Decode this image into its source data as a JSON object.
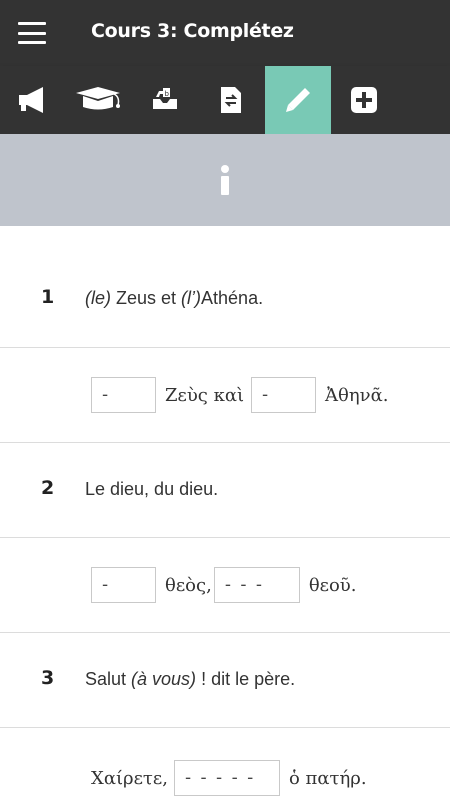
{
  "header": {
    "title": "Cours 3: Complétez"
  },
  "toolbar": {
    "tools": [
      {
        "icon": "megaphone-icon",
        "active": false
      },
      {
        "icon": "graduation-cap-icon",
        "active": false
      },
      {
        "icon": "inbox-icon",
        "active": false
      },
      {
        "icon": "document-swap-icon",
        "active": false
      },
      {
        "icon": "pencil-icon",
        "active": true
      },
      {
        "icon": "plus-square-icon",
        "active": false
      }
    ],
    "active_color": "#79c9b5"
  },
  "info": {
    "icon": "info-icon"
  },
  "exercises": [
    {
      "number": "1",
      "french_parts": {
        "a": "(le)",
        "b": " Zeus et ",
        "c": "(l’)",
        "d": "Athéna."
      },
      "greek": {
        "blank1": "-",
        "text1": "Ζεὺς καὶ",
        "blank2": "-",
        "text2": "Ἀθηνᾶ."
      }
    },
    {
      "number": "2",
      "french": "Le dieu, du dieu.",
      "greek": {
        "blank1": "-",
        "text1": "θεὸς,",
        "blank2": "- - -",
        "text2": "θεοῦ."
      }
    },
    {
      "number": "3",
      "french_parts": {
        "a": "Salut ",
        "b": "(à vous)",
        "c": " ! dit le père."
      },
      "greek": {
        "text0": "Χαίρετε,",
        "blank1": "- - - - -",
        "text1": "ὁ πατήρ."
      }
    }
  ],
  "colors": {
    "appbar": "#333333",
    "infobar": "#bfc4cc",
    "divider": "#dcdcdc"
  }
}
